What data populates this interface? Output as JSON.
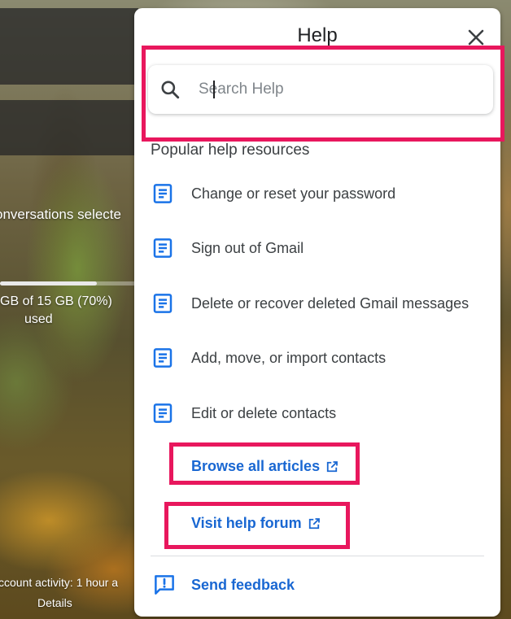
{
  "background": {
    "conversations_text": "onversations selecte",
    "storage_line1": "GB of 15 GB (70%)",
    "storage_line2": "used",
    "storage_fraction": 0.7,
    "account_activity": "ccount activity: 1 hour a",
    "details_link": "Details"
  },
  "help": {
    "title": "Help",
    "close_icon": "close-icon",
    "search": {
      "placeholder": "Search Help",
      "value": ""
    },
    "section_heading": "Popular help resources",
    "articles": [
      {
        "label": "Change or reset your password",
        "icon": "article-icon"
      },
      {
        "label": "Sign out of Gmail",
        "icon": "article-icon"
      },
      {
        "label": "Delete or recover deleted Gmail messages",
        "icon": "article-icon"
      },
      {
        "label": "Add, move, or import contacts",
        "icon": "article-icon"
      },
      {
        "label": "Edit or delete contacts",
        "icon": "article-icon"
      }
    ],
    "browse_all": "Browse all articles",
    "visit_forum": "Visit help forum",
    "send_feedback": "Send feedback"
  },
  "colors": {
    "link_blue": "#1967d2",
    "icon_blue": "#1a73e8",
    "highlight": "#e8175d"
  }
}
